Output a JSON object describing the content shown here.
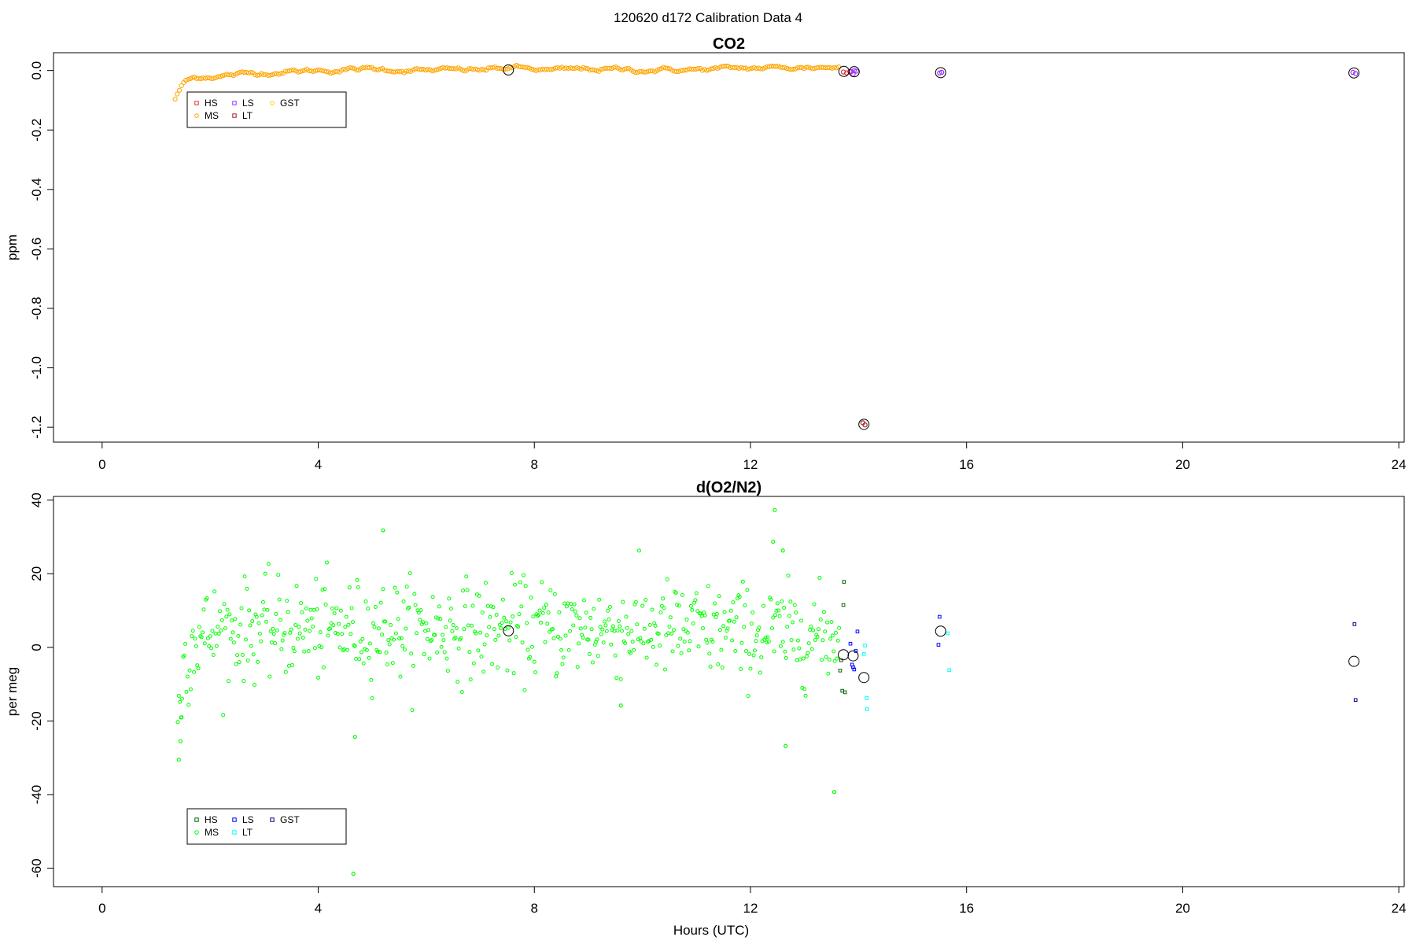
{
  "page": {
    "title": "120620   d172   Calibration Data 4",
    "xlabel": "Hours (UTC)"
  },
  "legend_entries": [
    {
      "key": "HS"
    },
    {
      "key": "MS"
    },
    {
      "key": "LS"
    },
    {
      "key": "LT"
    },
    {
      "key": "GST"
    }
  ],
  "chart_data": [
    {
      "type": "scatter",
      "title": "CO2",
      "xlabel": "",
      "ylabel": "ppm",
      "xlim": [
        -0.9,
        24.1
      ],
      "ylim": [
        -1.25,
        0.06
      ],
      "xticks": [
        0,
        4,
        8,
        12,
        16,
        20,
        24
      ],
      "yticks": [
        0.0,
        -0.2,
        -0.4,
        -0.6,
        -0.8,
        -1.0,
        -1.2
      ],
      "ytick_labels": [
        "0.0",
        "-0.2",
        "-0.4",
        "-0.6",
        "-0.8",
        "-1.0",
        "-1.2"
      ],
      "grid": false,
      "legend": {
        "placement": "top-left",
        "entries": [
          {
            "name": "HS",
            "color": "#e03030",
            "symbol": "square"
          },
          {
            "name": "MS",
            "color": "#ffa500",
            "symbol": "circle"
          },
          {
            "name": "LS",
            "color": "#9b30ff",
            "symbol": "square"
          },
          {
            "name": "LT",
            "color": "#a0202a",
            "symbol": "square"
          },
          {
            "name": "GST",
            "color": "#ffd700",
            "symbol": "circle"
          }
        ]
      },
      "ms_series": {
        "name": "MS",
        "color": "#ffa500",
        "x_start": 1.35,
        "x_end": 13.65,
        "step": 0.04,
        "y_anchors": [
          [
            1.35,
            -0.095
          ],
          [
            1.45,
            -0.06
          ],
          [
            1.55,
            -0.035
          ],
          [
            1.7,
            -0.025
          ],
          [
            1.9,
            -0.02
          ],
          [
            2.2,
            -0.018
          ],
          [
            2.6,
            -0.012
          ],
          [
            2.9,
            -0.008
          ],
          [
            3.2,
            -0.005
          ],
          [
            4.0,
            0.0
          ],
          [
            5.0,
            0.005
          ],
          [
            6.0,
            0.0
          ],
          [
            7.0,
            0.002
          ],
          [
            7.6,
            0.01
          ],
          [
            8.3,
            0.0
          ],
          [
            9.0,
            0.005
          ],
          [
            10.0,
            0.002
          ],
          [
            11.0,
            0.003
          ],
          [
            12.0,
            0.008
          ],
          [
            13.0,
            0.01
          ],
          [
            13.65,
            0.012
          ]
        ],
        "noise": 0.006
      },
      "points": [
        {
          "series": "HS",
          "color": "#e03030",
          "x": 13.72,
          "y": -0.005
        },
        {
          "series": "HS",
          "color": "#e03030",
          "x": 13.78,
          "y": -0.008
        },
        {
          "series": "HS",
          "color": "#e03030",
          "x": 13.84,
          "y": -0.004
        },
        {
          "series": "LS",
          "color": "#9b30ff",
          "x": 13.87,
          "y": -0.003
        },
        {
          "series": "LS",
          "color": "#9b30ff",
          "x": 13.92,
          "y": 0.0
        },
        {
          "series": "LS",
          "color": "#9b30ff",
          "x": 13.96,
          "y": -0.002
        },
        {
          "series": "LS",
          "color": "#9b30ff",
          "x": 13.9,
          "y": -0.012
        },
        {
          "series": "LT",
          "color": "#a0202a",
          "x": 14.08,
          "y": -1.185
        },
        {
          "series": "LT",
          "color": "#a0202a",
          "x": 14.12,
          "y": -1.192
        },
        {
          "series": "LS",
          "color": "#9b30ff",
          "x": 15.5,
          "y": -0.008
        },
        {
          "series": "LS",
          "color": "#9b30ff",
          "x": 15.54,
          "y": -0.006
        },
        {
          "series": "GST",
          "color": "#9b30ff",
          "x": 23.15,
          "y": -0.006
        },
        {
          "series": "GST",
          "color": "#9b30ff",
          "x": 23.2,
          "y": -0.01
        }
      ],
      "means": [
        {
          "x": 7.52,
          "y": 0.002
        },
        {
          "x": 13.73,
          "y": -0.003
        },
        {
          "x": 13.92,
          "y": -0.004
        },
        {
          "x": 14.1,
          "y": -1.19
        },
        {
          "x": 15.52,
          "y": -0.007
        },
        {
          "x": 23.17,
          "y": -0.008
        }
      ]
    },
    {
      "type": "scatter",
      "title": "d(O2/N2)",
      "xlabel": "Hours (UTC)",
      "ylabel": "per meg",
      "xlim": [
        -0.9,
        24.1
      ],
      "ylim": [
        -65,
        41
      ],
      "xticks": [
        0,
        4,
        8,
        12,
        16,
        20,
        24
      ],
      "yticks": [
        40,
        20,
        0,
        -20,
        -40,
        -60
      ],
      "ytick_labels": [
        "40",
        "20",
        "0",
        "-20",
        "-40",
        "-60"
      ],
      "grid": false,
      "legend": {
        "placement": "bottom-left",
        "entries": [
          {
            "name": "HS",
            "color": "#006400",
            "symbol": "square"
          },
          {
            "name": "MS",
            "color": "#00ff00",
            "symbol": "circle"
          },
          {
            "name": "LS",
            "color": "#0000ff",
            "symbol": "square"
          },
          {
            "name": "LT",
            "color": "#00ffff",
            "symbol": "square"
          },
          {
            "name": "GST",
            "color": "#00008b",
            "symbol": "square"
          }
        ]
      },
      "ms_series": {
        "name": "MS",
        "color": "#00ff00",
        "x_start": 1.4,
        "x_end": 13.65,
        "step": 0.02,
        "y_anchors": [
          [
            1.4,
            -20
          ],
          [
            1.5,
            -5
          ],
          [
            1.7,
            2
          ],
          [
            2.0,
            4
          ],
          [
            3.0,
            5
          ],
          [
            4.0,
            5
          ],
          [
            6.0,
            5
          ],
          [
            8.0,
            5
          ],
          [
            10.0,
            5
          ],
          [
            12.0,
            4
          ],
          [
            13.65,
            3
          ]
        ],
        "noise": 6.5
      },
      "points": [
        {
          "series": "MS",
          "color": "#00ff00",
          "x": 1.42,
          "y": -30.5
        },
        {
          "series": "MS",
          "color": "#00ff00",
          "x": 1.45,
          "y": -25.5
        },
        {
          "series": "MS",
          "color": "#00ff00",
          "x": 1.47,
          "y": -19
        },
        {
          "series": "MS",
          "color": "#00ff00",
          "x": 4.65,
          "y": -61.5
        },
        {
          "series": "MS",
          "color": "#00ff00",
          "x": 4.68,
          "y": -24.3
        },
        {
          "series": "MS",
          "color": "#00ff00",
          "x": 5.2,
          "y": 31.8
        },
        {
          "series": "MS",
          "color": "#00ff00",
          "x": 12.45,
          "y": 37.3
        },
        {
          "series": "MS",
          "color": "#00ff00",
          "x": 12.42,
          "y": 28.7
        },
        {
          "series": "MS",
          "color": "#00ff00",
          "x": 12.6,
          "y": 26.3
        },
        {
          "series": "MS",
          "color": "#00ff00",
          "x": 12.65,
          "y": -26.8
        },
        {
          "series": "MS",
          "color": "#00ff00",
          "x": 13.55,
          "y": -39.3
        },
        {
          "series": "MS",
          "color": "#00ff00",
          "x": 9.6,
          "y": -15.8
        },
        {
          "series": "HS",
          "color": "#006400",
          "x": 13.73,
          "y": 17.8
        },
        {
          "series": "HS",
          "color": "#006400",
          "x": 13.72,
          "y": 11.5
        },
        {
          "series": "HS",
          "color": "#006400",
          "x": 13.68,
          "y": -3.5
        },
        {
          "series": "HS",
          "color": "#006400",
          "x": 13.66,
          "y": -6.3
        },
        {
          "series": "HS",
          "color": "#006400",
          "x": 13.7,
          "y": -11.8
        },
        {
          "series": "HS",
          "color": "#006400",
          "x": 13.75,
          "y": -12.2
        },
        {
          "series": "LS",
          "color": "#0000ff",
          "x": 13.85,
          "y": 1.0
        },
        {
          "series": "LS",
          "color": "#0000ff",
          "x": 13.88,
          "y": -4.7
        },
        {
          "series": "LS",
          "color": "#0000ff",
          "x": 13.9,
          "y": -5.4
        },
        {
          "series": "LS",
          "color": "#0000ff",
          "x": 13.92,
          "y": -6.0
        },
        {
          "series": "LS",
          "color": "#0000ff",
          "x": 13.98,
          "y": 4.3
        },
        {
          "series": "LS",
          "color": "#0000ff",
          "x": 13.95,
          "y": -1.0
        },
        {
          "series": "LT",
          "color": "#00ffff",
          "x": 14.1,
          "y": -1.8
        },
        {
          "series": "LT",
          "color": "#00ffff",
          "x": 14.12,
          "y": 0.5
        },
        {
          "series": "LT",
          "color": "#00ffff",
          "x": 14.15,
          "y": -13.8
        },
        {
          "series": "LT",
          "color": "#00ffff",
          "x": 14.16,
          "y": -16.8
        },
        {
          "series": "LS",
          "color": "#0000ff",
          "x": 15.5,
          "y": 8.3
        },
        {
          "series": "LS",
          "color": "#0000ff",
          "x": 15.48,
          "y": 0.7
        },
        {
          "series": "LT",
          "color": "#00ffff",
          "x": 15.68,
          "y": -6.2
        },
        {
          "series": "LT",
          "color": "#00ffff",
          "x": 15.65,
          "y": 3.8
        },
        {
          "series": "GST",
          "color": "#00008b",
          "x": 23.18,
          "y": 6.3
        },
        {
          "series": "GST",
          "color": "#00008b",
          "x": 23.2,
          "y": -14.3
        }
      ],
      "means": [
        {
          "x": 7.52,
          "y": 4.5
        },
        {
          "x": 13.72,
          "y": -2.0
        },
        {
          "x": 13.9,
          "y": -2.3
        },
        {
          "x": 14.1,
          "y": -8.2
        },
        {
          "x": 15.52,
          "y": 4.4
        },
        {
          "x": 23.17,
          "y": -3.8
        }
      ]
    }
  ]
}
